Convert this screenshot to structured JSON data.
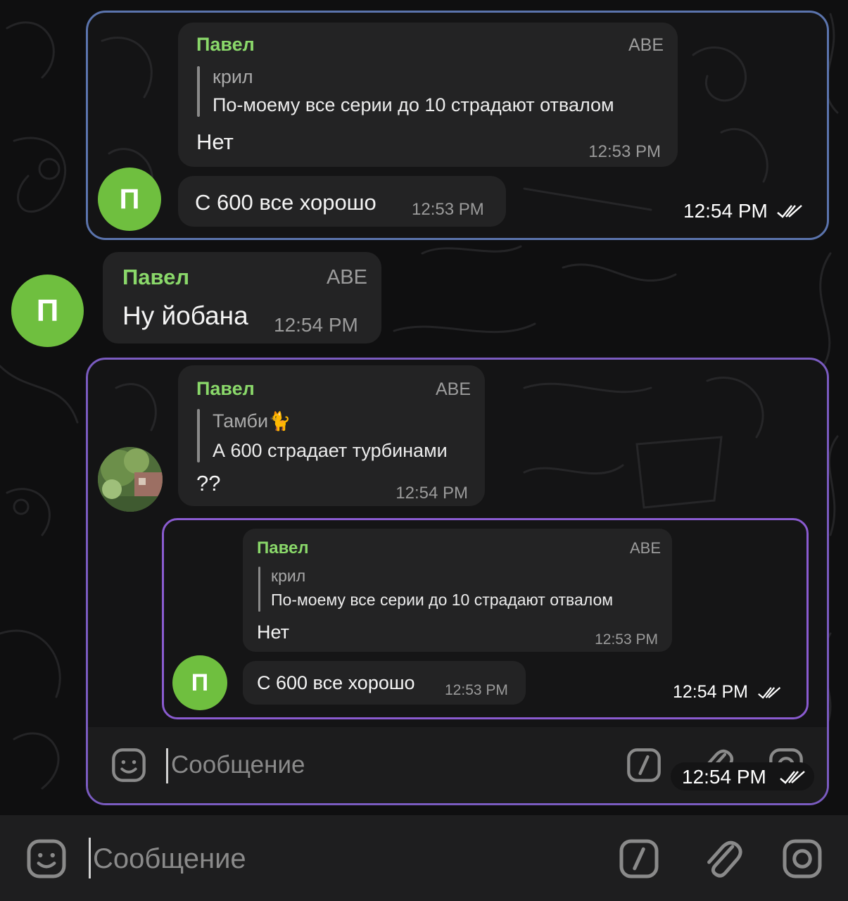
{
  "messages": {
    "top_card": {
      "reply_msg": {
        "sender": "Павел",
        "tag": "ABE",
        "reply_to": {
          "name": "крил",
          "text": "По-моему все серии до 10 страдают отвалом"
        },
        "text": "Нет",
        "time": "12:53 PM"
      },
      "followup": {
        "avatar_letter": "П",
        "text": "С 600 все хорошо",
        "time": "12:53 PM"
      },
      "screenshot_time": "12:54 PM"
    },
    "standalone": {
      "avatar_letter": "П",
      "sender": "Павел",
      "tag": "ABE",
      "text": "Ну йобана",
      "time": "12:54 PM"
    },
    "bottom_card": {
      "reply_msg": {
        "sender": "Павел",
        "tag": "ABE",
        "reply_to": {
          "name": "Тамби",
          "emoji": "🐈",
          "text": "А 600 страдает турбинами"
        },
        "text": "??",
        "time": "12:54 PM"
      },
      "nested": {
        "reply_msg": {
          "sender": "Павел",
          "tag": "ABE",
          "reply_to": {
            "name": "крил",
            "text": "По-моему все серии до 10 страдают отвалом"
          },
          "text": "Нет",
          "time": "12:53 PM"
        },
        "followup": {
          "avatar_letter": "П",
          "text": "С 600 все хорошо",
          "time": "12:53 PM"
        },
        "screenshot_time": "12:54 PM"
      },
      "input_placeholder": "Сообщение",
      "screenshot_time": "12:54 PM"
    }
  },
  "composer": {
    "placeholder": "Сообщение",
    "icons": [
      "sticker-icon",
      "command-icon",
      "attach-icon",
      "camera-icon"
    ]
  },
  "colors": {
    "sender": "#8ad86a",
    "avatar": "#6fbf3f",
    "bubble": "#232324",
    "frame_top": "#5b74ad",
    "frame_bottom": "#7a5bc0"
  }
}
